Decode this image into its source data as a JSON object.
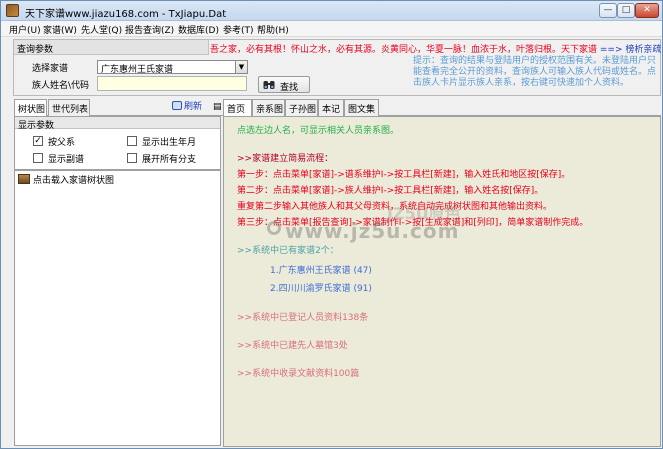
{
  "window": {
    "title": "天下家谱www.jiazu168.com - TxJiapu.Dat",
    "controls": {
      "minimize": "—",
      "maximize": "□",
      "close": "✕"
    }
  },
  "menu": [
    "用户(U)",
    "家谱(W)",
    "先人堂(Q)",
    "报告查询(Z)",
    "数据库(D)",
    "参考(T)",
    "帮助(H)"
  ],
  "query": {
    "section_title": "查询参数",
    "family_label": "选择家谱",
    "family_value": "广东惠州王氏家谱",
    "name_label": "族人姓名\\代码",
    "name_value": "",
    "search_button": "查找",
    "slogan": "吾之家，必有其根！怀山之水，必有其源。炎黄同心，华夏一脉！血浓于水，叶落归根。天下家谱",
    "slogan_link": "==> 榜析亲疏",
    "tip": "提示：查询的结果与登陆用户的授权范围有关。未登陆用户只能查看完全公开的资料，查询族人可输入族人代码或姓名。点击族人卡片显示族人亲系，按右键可快速加个人资料。"
  },
  "left_pane": {
    "tabs": [
      "树状图",
      "世代列表"
    ],
    "refresh": "刷新",
    "display_title": "显示参数",
    "options": [
      {
        "label": "按父系",
        "checked": true
      },
      {
        "label": "显示出生年月",
        "checked": false
      },
      {
        "label": "显示副谱",
        "checked": false
      },
      {
        "label": "展开所有分支",
        "checked": false
      }
    ],
    "tree_item": "点击载入家谱树状图"
  },
  "right_pane": {
    "tabs": [
      "首页",
      "亲系图",
      "子孙图",
      "本记",
      "图文集"
    ],
    "hint": "点选左边人名，可显示相关人员亲系图。",
    "flow_title": ">>家谱建立简易流程：",
    "steps": [
      "第一步：点击菜单[家谱]->谱系维护I->按工具栏[新建]，输入姓氏和地区按[保存]。",
      "第二步：点击菜单[家谱]->族人维护I->按工具栏[新建]，输入姓名按[保存]。",
      "重复第二步输入其他族人和其父母资料，系统自动完成树状图和其他输出资料。",
      "第三步：点击菜单[报告查询]->家谱制作I->按[生成家谱]和[列印]，简单家谱制作完成。"
    ],
    "family_list_title": ">>系统中已有家谱2个：",
    "families": [
      "1.广东惠州王氏家谱 (47)",
      "2.四川川渝罗氏家谱 (91)"
    ],
    "stats": [
      ">>系统中已登记人员资料138条",
      ">>系统中已建先人墓馆3处",
      ">>系统中收录文献资料100篇"
    ]
  },
  "watermark": {
    "main": "www.jz5u.com",
    "sub": "JZ5U原色"
  },
  "colors": {
    "step_red": "#e8001c",
    "hint_green": "#21b04a",
    "link_blue": "#3f6fd8",
    "content_bg": "#ecead8"
  }
}
